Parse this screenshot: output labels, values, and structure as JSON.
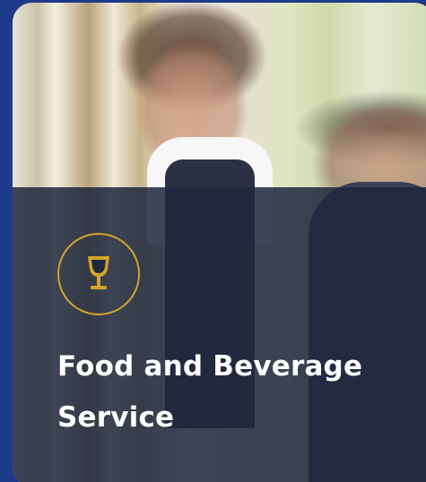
{
  "card": {
    "title": "Food and Beverage Service",
    "icon": "wine-glass-icon",
    "accent_color": "#d4a52a",
    "overlay_color": "#1e283e",
    "background_color": "#1e3a8a"
  }
}
